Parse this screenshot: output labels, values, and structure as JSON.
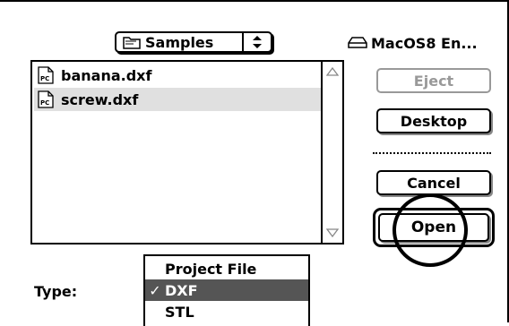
{
  "folder_popup": {
    "label": "Samples",
    "icon": "folder-icon"
  },
  "volume": {
    "label": "MacOS8 En...",
    "icon": "hard-disk-icon"
  },
  "file_list": {
    "items": [
      {
        "name": "banana.dxf",
        "badge": "PC",
        "selected": false
      },
      {
        "name": "screw.dxf",
        "badge": "PC",
        "selected": true
      }
    ]
  },
  "buttons": {
    "eject": "Eject",
    "desktop": "Desktop",
    "cancel": "Cancel",
    "open": "Open"
  },
  "type": {
    "label": "Type:",
    "options": [
      {
        "label": "Project File",
        "selected": false
      },
      {
        "label": "DXF",
        "selected": true
      },
      {
        "label": "STL",
        "selected": false
      }
    ],
    "check_glyph": "✓"
  }
}
